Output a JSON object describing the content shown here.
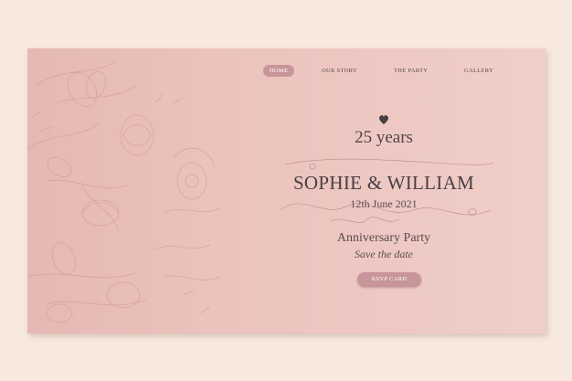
{
  "nav": {
    "items": [
      {
        "label": "HOME",
        "active": true
      },
      {
        "label": "OUR STORY",
        "active": false
      },
      {
        "label": "THE PARTY",
        "active": false
      },
      {
        "label": "GALLERY",
        "active": false
      }
    ]
  },
  "hero": {
    "years": "25 years",
    "names": "SOPHIE & WILLIAM",
    "date": "12th June 2021",
    "event": "Anniversary Party",
    "tagline": "Save the date",
    "button_label": "RSVP CARD"
  },
  "colors": {
    "page_background": "#f7e9de",
    "card_pink": "#ebc2bc",
    "accent": "#c7959a",
    "text": "#4a3f45"
  },
  "icons": [
    "heart-icon",
    "floral-illustration",
    "flourish-ornament"
  ]
}
